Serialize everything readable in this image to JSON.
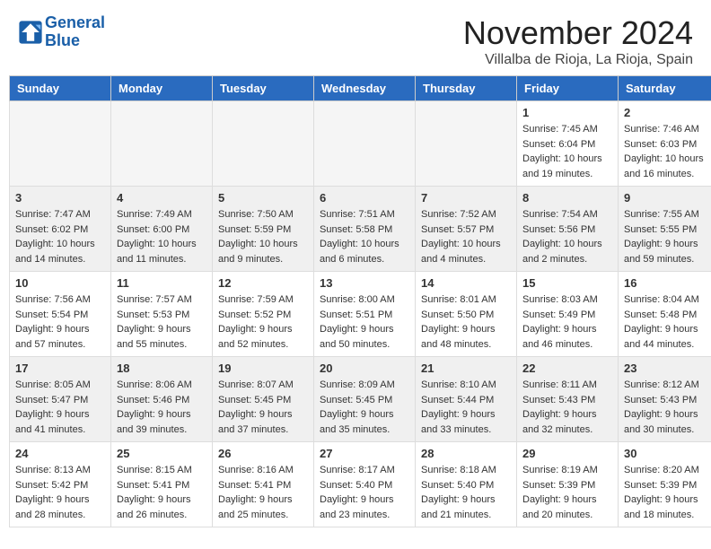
{
  "header": {
    "logo_line1": "General",
    "logo_line2": "Blue",
    "title": "November 2024",
    "location": "Villalba de Rioja, La Rioja, Spain"
  },
  "weekdays": [
    "Sunday",
    "Monday",
    "Tuesday",
    "Wednesday",
    "Thursday",
    "Friday",
    "Saturday"
  ],
  "weeks": [
    {
      "alt": false,
      "days": [
        {
          "num": "",
          "info": ""
        },
        {
          "num": "",
          "info": ""
        },
        {
          "num": "",
          "info": ""
        },
        {
          "num": "",
          "info": ""
        },
        {
          "num": "",
          "info": ""
        },
        {
          "num": "1",
          "info": "Sunrise: 7:45 AM\nSunset: 6:04 PM\nDaylight: 10 hours and 19 minutes."
        },
        {
          "num": "2",
          "info": "Sunrise: 7:46 AM\nSunset: 6:03 PM\nDaylight: 10 hours and 16 minutes."
        }
      ]
    },
    {
      "alt": true,
      "days": [
        {
          "num": "3",
          "info": "Sunrise: 7:47 AM\nSunset: 6:02 PM\nDaylight: 10 hours and 14 minutes."
        },
        {
          "num": "4",
          "info": "Sunrise: 7:49 AM\nSunset: 6:00 PM\nDaylight: 10 hours and 11 minutes."
        },
        {
          "num": "5",
          "info": "Sunrise: 7:50 AM\nSunset: 5:59 PM\nDaylight: 10 hours and 9 minutes."
        },
        {
          "num": "6",
          "info": "Sunrise: 7:51 AM\nSunset: 5:58 PM\nDaylight: 10 hours and 6 minutes."
        },
        {
          "num": "7",
          "info": "Sunrise: 7:52 AM\nSunset: 5:57 PM\nDaylight: 10 hours and 4 minutes."
        },
        {
          "num": "8",
          "info": "Sunrise: 7:54 AM\nSunset: 5:56 PM\nDaylight: 10 hours and 2 minutes."
        },
        {
          "num": "9",
          "info": "Sunrise: 7:55 AM\nSunset: 5:55 PM\nDaylight: 9 hours and 59 minutes."
        }
      ]
    },
    {
      "alt": false,
      "days": [
        {
          "num": "10",
          "info": "Sunrise: 7:56 AM\nSunset: 5:54 PM\nDaylight: 9 hours and 57 minutes."
        },
        {
          "num": "11",
          "info": "Sunrise: 7:57 AM\nSunset: 5:53 PM\nDaylight: 9 hours and 55 minutes."
        },
        {
          "num": "12",
          "info": "Sunrise: 7:59 AM\nSunset: 5:52 PM\nDaylight: 9 hours and 52 minutes."
        },
        {
          "num": "13",
          "info": "Sunrise: 8:00 AM\nSunset: 5:51 PM\nDaylight: 9 hours and 50 minutes."
        },
        {
          "num": "14",
          "info": "Sunrise: 8:01 AM\nSunset: 5:50 PM\nDaylight: 9 hours and 48 minutes."
        },
        {
          "num": "15",
          "info": "Sunrise: 8:03 AM\nSunset: 5:49 PM\nDaylight: 9 hours and 46 minutes."
        },
        {
          "num": "16",
          "info": "Sunrise: 8:04 AM\nSunset: 5:48 PM\nDaylight: 9 hours and 44 minutes."
        }
      ]
    },
    {
      "alt": true,
      "days": [
        {
          "num": "17",
          "info": "Sunrise: 8:05 AM\nSunset: 5:47 PM\nDaylight: 9 hours and 41 minutes."
        },
        {
          "num": "18",
          "info": "Sunrise: 8:06 AM\nSunset: 5:46 PM\nDaylight: 9 hours and 39 minutes."
        },
        {
          "num": "19",
          "info": "Sunrise: 8:07 AM\nSunset: 5:45 PM\nDaylight: 9 hours and 37 minutes."
        },
        {
          "num": "20",
          "info": "Sunrise: 8:09 AM\nSunset: 5:45 PM\nDaylight: 9 hours and 35 minutes."
        },
        {
          "num": "21",
          "info": "Sunrise: 8:10 AM\nSunset: 5:44 PM\nDaylight: 9 hours and 33 minutes."
        },
        {
          "num": "22",
          "info": "Sunrise: 8:11 AM\nSunset: 5:43 PM\nDaylight: 9 hours and 32 minutes."
        },
        {
          "num": "23",
          "info": "Sunrise: 8:12 AM\nSunset: 5:43 PM\nDaylight: 9 hours and 30 minutes."
        }
      ]
    },
    {
      "alt": false,
      "days": [
        {
          "num": "24",
          "info": "Sunrise: 8:13 AM\nSunset: 5:42 PM\nDaylight: 9 hours and 28 minutes."
        },
        {
          "num": "25",
          "info": "Sunrise: 8:15 AM\nSunset: 5:41 PM\nDaylight: 9 hours and 26 minutes."
        },
        {
          "num": "26",
          "info": "Sunrise: 8:16 AM\nSunset: 5:41 PM\nDaylight: 9 hours and 25 minutes."
        },
        {
          "num": "27",
          "info": "Sunrise: 8:17 AM\nSunset: 5:40 PM\nDaylight: 9 hours and 23 minutes."
        },
        {
          "num": "28",
          "info": "Sunrise: 8:18 AM\nSunset: 5:40 PM\nDaylight: 9 hours and 21 minutes."
        },
        {
          "num": "29",
          "info": "Sunrise: 8:19 AM\nSunset: 5:39 PM\nDaylight: 9 hours and 20 minutes."
        },
        {
          "num": "30",
          "info": "Sunrise: 8:20 AM\nSunset: 5:39 PM\nDaylight: 9 hours and 18 minutes."
        }
      ]
    }
  ]
}
